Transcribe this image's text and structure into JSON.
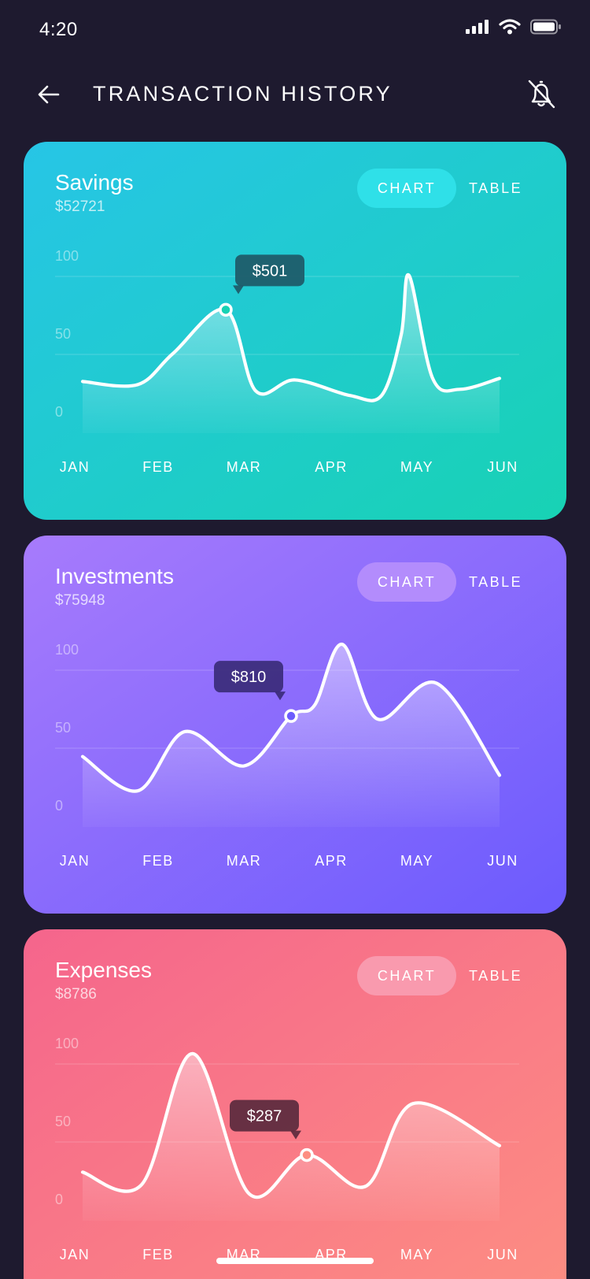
{
  "status": {
    "time": "4:20"
  },
  "header": {
    "title": "TRANSACTION HISTORY"
  },
  "toggles": {
    "chart": "CHART",
    "table": "TABLE"
  },
  "cards": [
    {
      "title": "Savings",
      "amount": "$52721",
      "tooltip": "$501",
      "colors": {
        "from": "#27c5e6",
        "to": "#18d2b4",
        "tooltip": "#1e5967",
        "active_toggle": "#2fe0e8"
      }
    },
    {
      "title": "Investments",
      "amount": "$75948",
      "tooltip": "$810",
      "colors": {
        "from": "#a77bfc",
        "to": "#6c5bfd",
        "tooltip": "#3b2b7a",
        "active_toggle": "#b38cfc"
      }
    },
    {
      "title": "Expenses",
      "amount": "$8786",
      "tooltip": "$287",
      "colors": {
        "from": "#f5658c",
        "to": "#fd8e82",
        "tooltip": "#5a2a3d",
        "active_toggle": "#f99aae"
      }
    }
  ],
  "chart_data": [
    {
      "type": "line",
      "x": [
        "JAN",
        "FEB",
        "MAR",
        "APR",
        "MAY",
        "JUN"
      ],
      "y_ticks": [
        "100",
        "50",
        "0"
      ],
      "ylim": [
        0,
        100
      ],
      "series": [
        {
          "x": [
            0,
            0.7,
            1.15,
            1.82,
            2.2,
            2.7,
            3.4,
            3.8,
            4.05,
            4.15,
            4.45,
            4.8,
            5.3
          ],
          "y": [
            20,
            18,
            38,
            66,
            14,
            21,
            11,
            11,
            50,
            88,
            22,
            15,
            22
          ]
        }
      ],
      "highlight": {
        "x": 1.82,
        "y": 66,
        "label": "$501"
      }
    },
    {
      "type": "line",
      "x": [
        "JAN",
        "FEB",
        "MAR",
        "APR",
        "MAY",
        "JUN"
      ],
      "y_ticks": [
        "100",
        "50",
        "0"
      ],
      "ylim": [
        0,
        100
      ],
      "series": [
        {
          "x": [
            0,
            0.7,
            1.3,
            2.05,
            2.65,
            2.95,
            3.3,
            3.75,
            4.5,
            5.3
          ],
          "y": [
            32,
            10,
            48,
            26,
            58,
            65,
            104,
            56,
            79,
            20
          ]
        }
      ],
      "highlight": {
        "x": 2.65,
        "y": 58,
        "label": "$810"
      }
    },
    {
      "type": "line",
      "x": [
        "JAN",
        "FEB",
        "MAR",
        "APR",
        "MAY",
        "JUN"
      ],
      "y_ticks": [
        "100",
        "50",
        "0"
      ],
      "ylim": [
        0,
        100
      ],
      "series": [
        {
          "x": [
            0,
            0.75,
            1.4,
            2.12,
            2.85,
            3.6,
            4.2,
            5.3
          ],
          "y": [
            18,
            10,
            94,
            4,
            29,
            9,
            62,
            35
          ]
        }
      ],
      "highlight": {
        "x": 2.85,
        "y": 29,
        "label": "$287"
      }
    }
  ]
}
